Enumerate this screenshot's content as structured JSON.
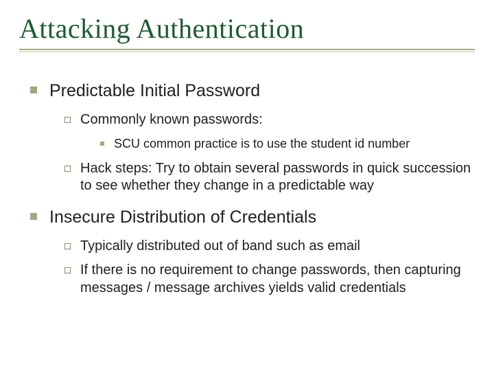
{
  "title": "Attacking Authentication",
  "items": [
    {
      "level": 1,
      "text": "Predictable Initial Password"
    },
    {
      "level": 2,
      "text": "Commonly known passwords:"
    },
    {
      "level": 3,
      "text": "SCU common practice is to use the student id number"
    },
    {
      "level": 2,
      "text": "Hack steps: Try to obtain several passwords in quick succession to see whether they change in a predictable way"
    },
    {
      "level": 1,
      "text": "Insecure Distribution of Credentials"
    },
    {
      "level": 2,
      "text": "Typically distributed out of band such as email"
    },
    {
      "level": 2,
      "text": "If there is no requirement to change passwords, then capturing messages / message archives yields valid credentials"
    }
  ]
}
